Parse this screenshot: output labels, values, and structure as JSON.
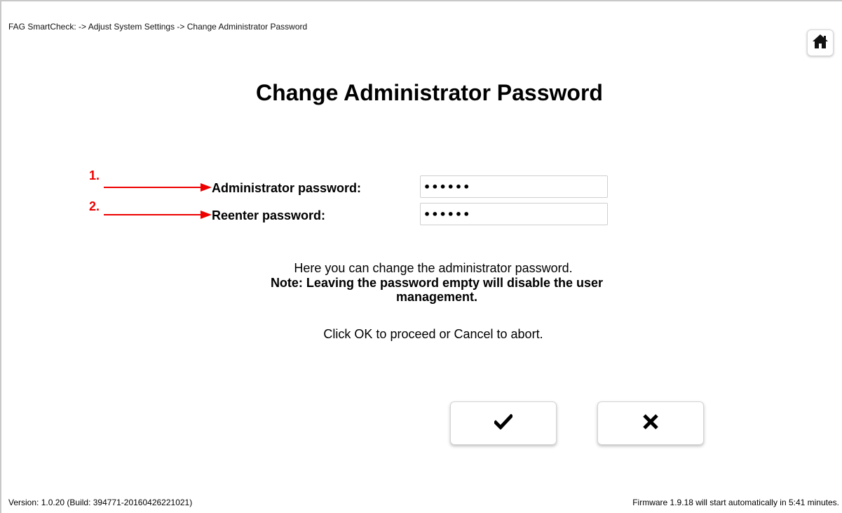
{
  "header": {
    "breadcrumb": "FAG SmartCheck: -> Adjust System Settings -> Change Administrator Password",
    "home_icon": "home-icon"
  },
  "main": {
    "title": "Change Administrator Password",
    "annotations": {
      "color": "#ee0000",
      "step1": "1.",
      "step2": "2."
    },
    "fields": [
      {
        "label": "Administrator password:",
        "value": "••••••"
      },
      {
        "label": "Reenter password:",
        "value": "••••••"
      }
    ],
    "info_line": "Here you can change the administrator password.",
    "note": "Note: Leaving the password empty will disable the user management.",
    "instruction": "Click OK to proceed or Cancel to abort."
  },
  "actions": {
    "ok_icon": "checkmark-icon",
    "cancel_icon": "cross-icon"
  },
  "footer": {
    "version": "Version: 1.0.20 (Build: 394771-20160426221021)",
    "firmware": "Firmware 1.9.18 will start automatically in 5:41 minutes."
  }
}
